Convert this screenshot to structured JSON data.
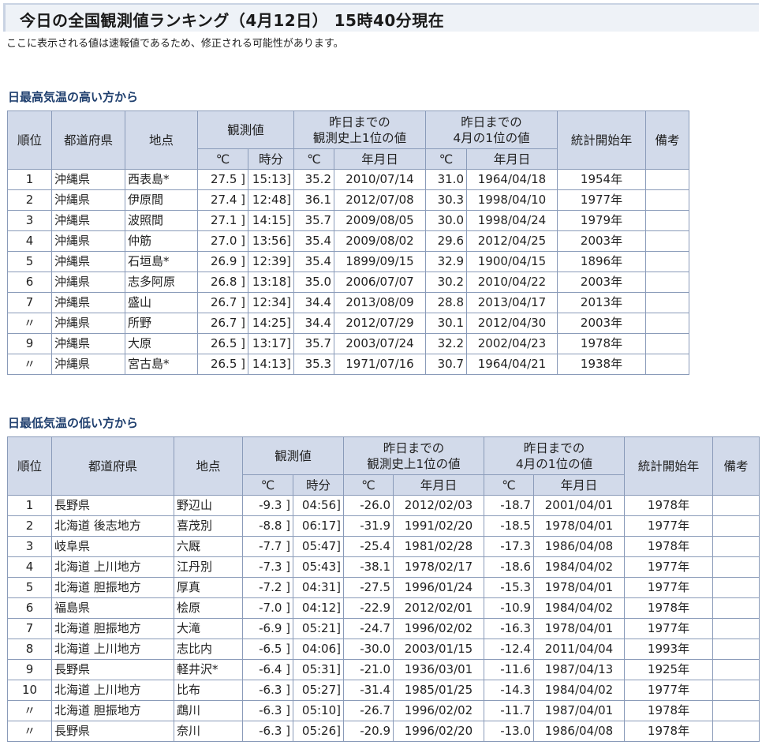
{
  "title": "今日の全国観測値ランキング（4月12日）  15時40分現在",
  "note": "ここに表示される値は速報値であるため、修正される可能性があります。",
  "header_labels": {
    "rank": "順位",
    "pref": "都道府県",
    "point": "地点",
    "obs": "観測値",
    "hist_record": "昨日までの観測史上1位の値",
    "hist_record_line1": "昨日までの",
    "hist_record_line2": "観測史上1位の値",
    "month_record_line1": "昨日までの",
    "month_record_line2": "4月の1位の値",
    "start_year": "統計開始年",
    "remarks": "備考",
    "deg": "℃",
    "time": "時分",
    "date": "年月日"
  },
  "high_section": {
    "heading": "日最高気温の高い方から",
    "rows": [
      {
        "rank": "1",
        "pref": "沖縄県",
        "point": "西表島*",
        "val": "27.5 ]",
        "time": "15:13]",
        "hv": "35.2",
        "hd": "2010/07/14",
        "mv": "31.0",
        "md": "1964/04/18",
        "start": "1954年",
        "rem": ""
      },
      {
        "rank": "2",
        "pref": "沖縄県",
        "point": "伊原間",
        "val": "27.4 ]",
        "time": "12:48]",
        "hv": "36.1",
        "hd": "2012/07/08",
        "mv": "30.3",
        "md": "1998/04/10",
        "start": "1977年",
        "rem": ""
      },
      {
        "rank": "3",
        "pref": "沖縄県",
        "point": "波照間",
        "val": "27.1 ]",
        "time": "14:15]",
        "hv": "35.7",
        "hd": "2009/08/05",
        "mv": "30.0",
        "md": "1998/04/24",
        "start": "1979年",
        "rem": ""
      },
      {
        "rank": "4",
        "pref": "沖縄県",
        "point": "仲筋",
        "val": "27.0 ]",
        "time": "13:56]",
        "hv": "35.4",
        "hd": "2009/08/02",
        "mv": "29.6",
        "md": "2012/04/25",
        "start": "2003年",
        "rem": ""
      },
      {
        "rank": "5",
        "pref": "沖縄県",
        "point": "石垣島*",
        "val": "26.9 ]",
        "time": "12:39]",
        "hv": "35.4",
        "hd": "1899/09/15",
        "mv": "32.9",
        "md": "1900/04/15",
        "start": "1896年",
        "rem": ""
      },
      {
        "rank": "6",
        "pref": "沖縄県",
        "point": "志多阿原",
        "val": "26.8 ]",
        "time": "13:18]",
        "hv": "35.0",
        "hd": "2006/07/07",
        "mv": "30.2",
        "md": "2010/04/22",
        "start": "2003年",
        "rem": ""
      },
      {
        "rank": "7",
        "pref": "沖縄県",
        "point": "盛山",
        "val": "26.7 ]",
        "time": "12:34]",
        "hv": "34.4",
        "hd": "2013/08/09",
        "mv": "28.8",
        "md": "2013/04/17",
        "start": "2013年",
        "rem": ""
      },
      {
        "rank": "〃",
        "pref": "沖縄県",
        "point": "所野",
        "val": "26.7 ]",
        "time": "14:25]",
        "hv": "34.4",
        "hd": "2012/07/29",
        "mv": "30.1",
        "md": "2012/04/30",
        "start": "2003年",
        "rem": ""
      },
      {
        "rank": "9",
        "pref": "沖縄県",
        "point": "大原",
        "val": "26.5 ]",
        "time": "13:17]",
        "hv": "35.7",
        "hd": "2003/07/24",
        "mv": "32.2",
        "md": "2002/04/23",
        "start": "1978年",
        "rem": ""
      },
      {
        "rank": "〃",
        "pref": "沖縄県",
        "point": "宮古島*",
        "val": "26.5 ]",
        "time": "14:13]",
        "hv": "35.3",
        "hd": "1971/07/16",
        "mv": "30.7",
        "md": "1964/04/21",
        "start": "1938年",
        "rem": ""
      }
    ]
  },
  "low_section": {
    "heading": "日最低気温の低い方から",
    "rows": [
      {
        "rank": "1",
        "pref": "長野県",
        "point": "野辺山",
        "val": "-9.3 ]",
        "time": "04:56]",
        "hv": "-26.0",
        "hd": "2012/02/03",
        "mv": "-18.7",
        "md": "2001/04/01",
        "start": "1978年",
        "rem": ""
      },
      {
        "rank": "2",
        "pref": "北海道 後志地方",
        "point": "喜茂別",
        "val": "-8.8 ]",
        "time": "06:17]",
        "hv": "-31.9",
        "hd": "1991/02/20",
        "mv": "-18.5",
        "md": "1978/04/01",
        "start": "1977年",
        "rem": ""
      },
      {
        "rank": "3",
        "pref": "岐阜県",
        "point": "六厩",
        "val": "-7.7 ]",
        "time": "05:47]",
        "hv": "-25.4",
        "hd": "1981/02/28",
        "mv": "-17.3",
        "md": "1986/04/08",
        "start": "1978年",
        "rem": ""
      },
      {
        "rank": "4",
        "pref": "北海道 上川地方",
        "point": "江丹別",
        "val": "-7.3 ]",
        "time": "05:43]",
        "hv": "-38.1",
        "hd": "1978/02/17",
        "mv": "-18.6",
        "md": "1984/04/02",
        "start": "1977年",
        "rem": ""
      },
      {
        "rank": "5",
        "pref": "北海道 胆振地方",
        "point": "厚真",
        "val": "-7.2 ]",
        "time": "04:31]",
        "hv": "-27.5",
        "hd": "1996/01/24",
        "mv": "-15.3",
        "md": "1978/04/01",
        "start": "1977年",
        "rem": ""
      },
      {
        "rank": "6",
        "pref": "福島県",
        "point": "桧原",
        "val": "-7.0 ]",
        "time": "04:12]",
        "hv": "-22.9",
        "hd": "2012/02/01",
        "mv": "-10.9",
        "md": "1984/04/02",
        "start": "1978年",
        "rem": ""
      },
      {
        "rank": "7",
        "pref": "北海道 胆振地方",
        "point": "大滝",
        "val": "-6.9 ]",
        "time": "05:21]",
        "hv": "-24.7",
        "hd": "1996/02/02",
        "mv": "-16.3",
        "md": "1978/04/01",
        "start": "1977年",
        "rem": ""
      },
      {
        "rank": "8",
        "pref": "北海道 上川地方",
        "point": "志比内",
        "val": "-6.5 ]",
        "time": "04:06]",
        "hv": "-30.0",
        "hd": "2003/01/15",
        "mv": "-12.4",
        "md": "2011/04/04",
        "start": "1993年",
        "rem": ""
      },
      {
        "rank": "9",
        "pref": "長野県",
        "point": "軽井沢*",
        "val": "-6.4 ]",
        "time": "05:31]",
        "hv": "-21.0",
        "hd": "1936/03/01",
        "mv": "-11.6",
        "md": "1987/04/13",
        "start": "1925年",
        "rem": ""
      },
      {
        "rank": "10",
        "pref": "北海道 上川地方",
        "point": "比布",
        "val": "-6.3 ]",
        "time": "05:27]",
        "hv": "-31.4",
        "hd": "1985/01/25",
        "mv": "-14.3",
        "md": "1984/04/02",
        "start": "1977年",
        "rem": ""
      },
      {
        "rank": "〃",
        "pref": "北海道 胆振地方",
        "point": "鵡川",
        "val": "-6.3 ]",
        "time": "05:10]",
        "hv": "-26.7",
        "hd": "1996/02/02",
        "mv": "-11.7",
        "md": "1987/04/01",
        "start": "1978年",
        "rem": ""
      },
      {
        "rank": "〃",
        "pref": "長野県",
        "point": "奈川",
        "val": "-6.3 ]",
        "time": "05:26]",
        "hv": "-20.9",
        "hd": "1996/02/20",
        "mv": "-13.0",
        "md": "1986/04/08",
        "start": "1978年",
        "rem": ""
      }
    ]
  }
}
